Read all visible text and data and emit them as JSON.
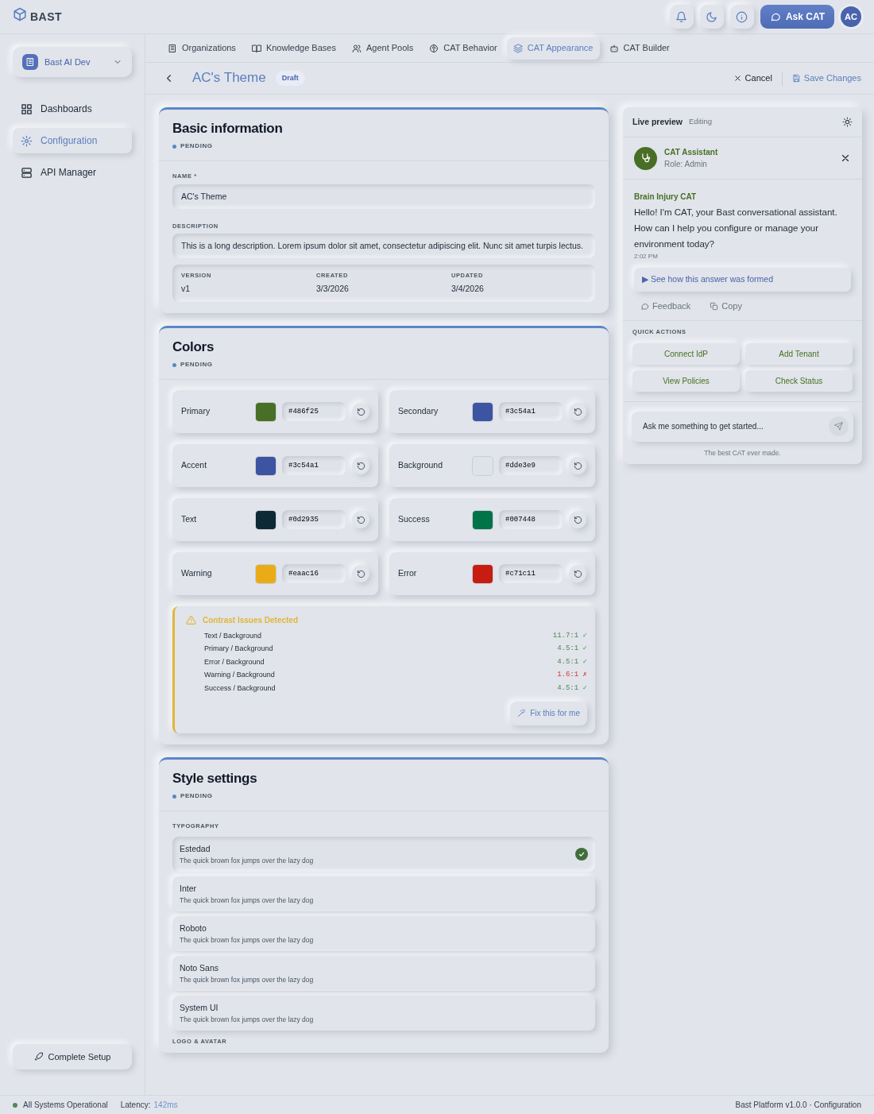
{
  "brand": "BAST",
  "header": {
    "ask_button": "Ask CAT",
    "avatar": "AC"
  },
  "workspace": "Bast AI Dev",
  "sidebar": {
    "items": [
      {
        "label": "Dashboards",
        "selected": false
      },
      {
        "label": "Configuration",
        "selected": true
      },
      {
        "label": "API Manager",
        "selected": false
      }
    ],
    "setup_button": "Complete Setup"
  },
  "tabs": [
    {
      "label": "Organizations",
      "selected": false
    },
    {
      "label": "Knowledge Bases",
      "selected": false
    },
    {
      "label": "Agent Pools",
      "selected": false
    },
    {
      "label": "CAT Behavior",
      "selected": false
    },
    {
      "label": "CAT Appearance",
      "selected": true
    },
    {
      "label": "CAT Builder",
      "selected": false
    }
  ],
  "page": {
    "title": "AC's Theme",
    "badge": "Draft",
    "cancel": "Cancel",
    "save": "Save Changes"
  },
  "basic": {
    "title": "Basic information",
    "status": "PENDING",
    "name_label": "NAME *",
    "name_value": "AC's Theme",
    "description_label": "DESCRIPTION",
    "description_value": "This is a long description. Lorem ipsum dolor sit amet, consectetur adipiscing elit. Nunc sit amet turpis lectus.",
    "meta": [
      {
        "label": "VERSION",
        "value": "v1"
      },
      {
        "label": "CREATED",
        "value": "3/3/2026"
      },
      {
        "label": "UPDATED",
        "value": "3/4/2026"
      }
    ]
  },
  "colors": {
    "title": "Colors",
    "status": "PENDING",
    "items": [
      {
        "label": "Primary",
        "value": "#486f25",
        "color": "#486f25"
      },
      {
        "label": "Secondary",
        "value": "#3c54a1",
        "color": "#3c54a1"
      },
      {
        "label": "Accent",
        "value": "#3c54a1",
        "color": "#3c54a1"
      },
      {
        "label": "Background",
        "value": "#dde3e9",
        "color": "#dde3e9"
      },
      {
        "label": "Text",
        "value": "#0d2935",
        "color": "#0d2935"
      },
      {
        "label": "Success",
        "value": "#007448",
        "color": "#007448"
      },
      {
        "label": "Warning",
        "value": "#eaac16",
        "color": "#eaac16"
      },
      {
        "label": "Error",
        "value": "#c71c11",
        "color": "#c71c11"
      }
    ],
    "contrast": {
      "title": "Contrast Issues Detected",
      "rows": [
        {
          "pair": "Text / Background",
          "ratio": "11.7:1",
          "mark": "✓",
          "passed": true
        },
        {
          "pair": "Primary / Background",
          "ratio": "4.5:1",
          "mark": "✓",
          "passed": true
        },
        {
          "pair": "Error / Background",
          "ratio": "4.5:1",
          "mark": "✓",
          "passed": true
        },
        {
          "pair": "Warning / Background",
          "ratio": "1.6:1",
          "mark": "✗",
          "passed": false
        },
        {
          "pair": "Success / Background",
          "ratio": "4.5:1",
          "mark": "✓",
          "passed": true
        }
      ],
      "fix_button": "Fix this for me"
    }
  },
  "style": {
    "title": "Style settings",
    "status": "PENDING",
    "typography_label": "TYPOGRAPHY",
    "fonts": [
      {
        "name": "Estedad",
        "sample": "The quick brown fox jumps over the lazy dog",
        "selected": true
      },
      {
        "name": "Inter",
        "sample": "The quick brown fox jumps over the lazy dog",
        "selected": false
      },
      {
        "name": "Roboto",
        "sample": "The quick brown fox jumps over the lazy dog",
        "selected": false
      },
      {
        "name": "Noto Sans",
        "sample": "The quick brown fox jumps over the lazy dog",
        "selected": false
      },
      {
        "name": "System UI",
        "sample": "The quick brown fox jumps over the lazy dog",
        "selected": false
      }
    ],
    "logo_label": "LOGO & AVATAR"
  },
  "preview": {
    "title": "Live preview",
    "state": "Editing",
    "assistant_name": "CAT Assistant",
    "assistant_role": "Role: Admin",
    "sender": "Brain Injury CAT",
    "message": "Hello! I'm CAT, your Bast conversational assistant. How can I help you configure or manage your environment today?",
    "time": "2:02 PM",
    "explain": "See how this answer was formed",
    "explain_marker": "▶",
    "feedback": "Feedback",
    "copy": "Copy",
    "quick_label": "QUICK ACTIONS",
    "quick_actions": [
      "Connect IdP",
      "Add Tenant",
      "View Policies",
      "Check Status"
    ],
    "input_placeholder": "Ask me something to get started...",
    "footer": "The best CAT ever made."
  },
  "status_bar": {
    "status": "All Systems Operational",
    "latency_label": "Latency:",
    "latency": "142ms",
    "info": "Bast Platform v1.0.0 · Configuration"
  }
}
